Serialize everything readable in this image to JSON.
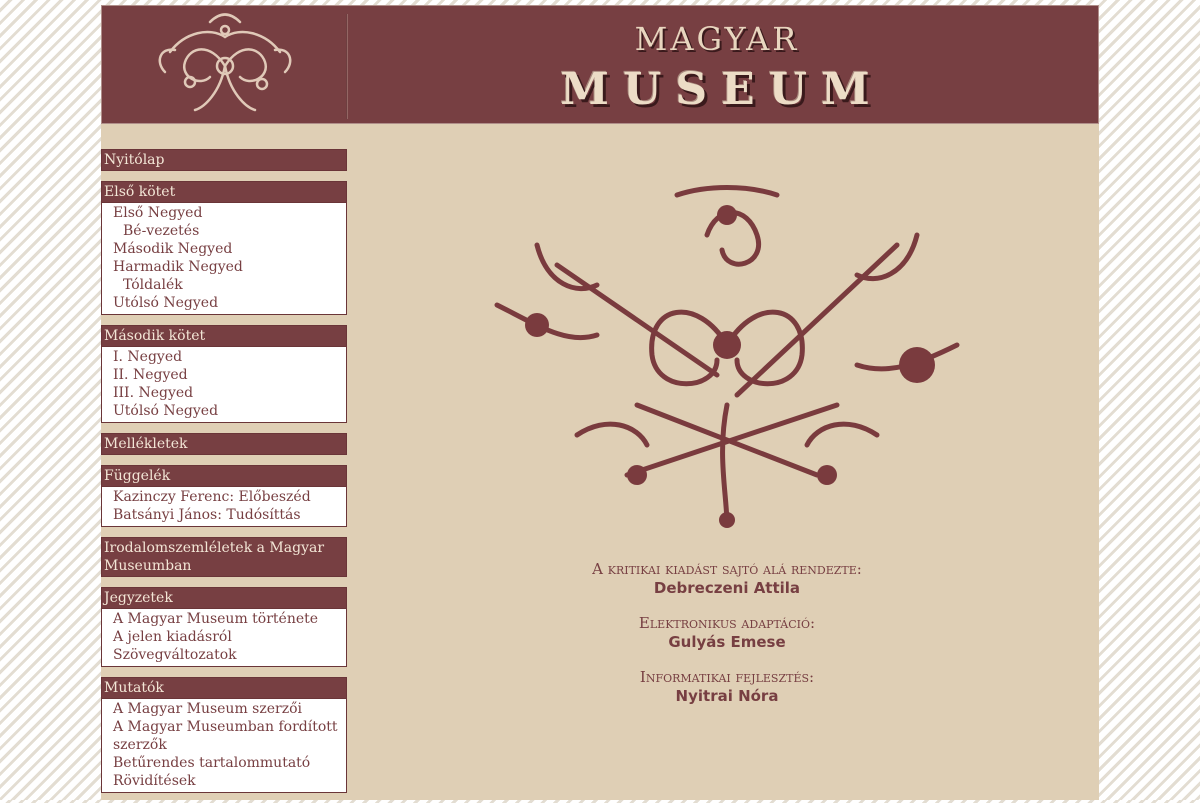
{
  "header": {
    "title_top": "MAGYAR",
    "title_main": "MUSEUM"
  },
  "sidebar": {
    "sections": [
      {
        "title": "Nyitólap",
        "items": []
      },
      {
        "title": "Első kötet",
        "items": [
          {
            "label": "Első Negyed",
            "sub": false
          },
          {
            "label": "Bé-vezetés",
            "sub": true
          },
          {
            "label": "Második Negyed",
            "sub": false
          },
          {
            "label": "Harmadik Negyed",
            "sub": false
          },
          {
            "label": "Tóldalék",
            "sub": true
          },
          {
            "label": "Utólsó Negyed",
            "sub": false
          }
        ]
      },
      {
        "title": "Második kötet",
        "items": [
          {
            "label": "I. Negyed",
            "sub": false
          },
          {
            "label": "II. Negyed",
            "sub": false
          },
          {
            "label": "III. Negyed",
            "sub": false
          },
          {
            "label": "Utólsó Negyed",
            "sub": false
          }
        ]
      },
      {
        "title": "Mellékletek",
        "items": []
      },
      {
        "title": "Függelék",
        "items": [
          {
            "label": "Kazinczy Ferenc: Előbeszéd",
            "sub": false
          },
          {
            "label": "Batsányi János: Tudósíttás",
            "sub": false
          }
        ]
      },
      {
        "title": "Irodalomszemléletek a Magyar Museumban",
        "items": []
      },
      {
        "title": "Jegyzetek",
        "items": [
          {
            "label": "A Magyar Museum története",
            "sub": false
          },
          {
            "label": "A jelen kiadásról",
            "sub": false
          },
          {
            "label": "Szövegváltozatok",
            "sub": false
          }
        ]
      },
      {
        "title": "Mutatók",
        "items": [
          {
            "label": "A Magyar Museum szerzői",
            "sub": false
          },
          {
            "label": "A Magyar Museumban fordított szerzők",
            "sub": false
          },
          {
            "label": "Betűrendes tartalommutató",
            "sub": false
          },
          {
            "label": "Rövidítések",
            "sub": false
          }
        ]
      }
    ]
  },
  "credits": [
    {
      "label": "A kritikai kiadást sajtó alá rendezte:",
      "name": "Debreczeni Attila"
    },
    {
      "label": "Elektronikus adaptáció:",
      "name": "Gulyás Emese"
    },
    {
      "label": "Informatikai fejlesztés:",
      "name": "Nyitrai Nóra"
    }
  ],
  "colors": {
    "accent": "#773f42",
    "page_bg": "#dfcfb5",
    "panel_bg": "#ffffff"
  },
  "icons": {
    "banner_logo": "floral-ornament-icon",
    "main_ornament": "floral-trumpet-ornament"
  }
}
